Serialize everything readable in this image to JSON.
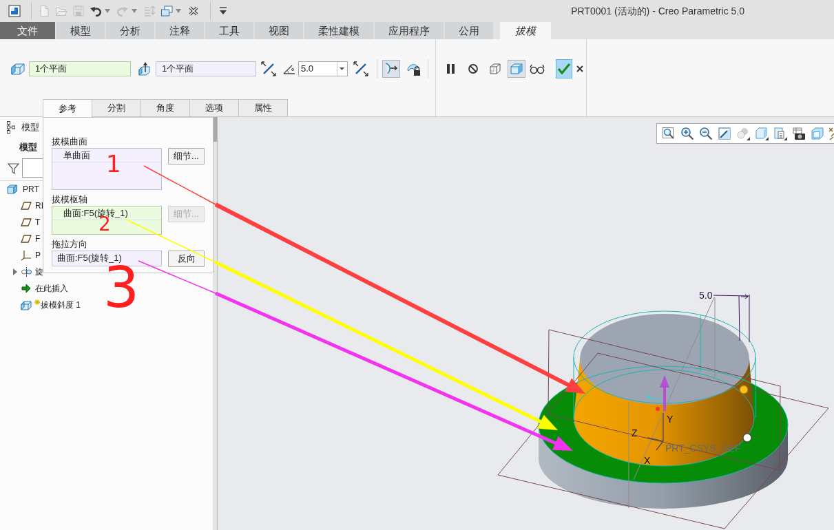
{
  "window": {
    "title": "PRT0001 (活动的) - Creo Parametric 5.0"
  },
  "quick_access": [
    {
      "kind": "app",
      "disabled": false,
      "menu": false
    },
    {
      "kind": "new",
      "disabled": true,
      "menu": false
    },
    {
      "kind": "open",
      "disabled": true,
      "menu": false
    },
    {
      "kind": "save",
      "disabled": true,
      "menu": false
    },
    {
      "kind": "undo",
      "disabled": false,
      "menu": true
    },
    {
      "kind": "redo",
      "disabled": true,
      "menu": true
    },
    {
      "kind": "regenerate",
      "disabled": true,
      "menu": false
    },
    {
      "kind": "windows",
      "disabled": false,
      "menu": true
    },
    {
      "kind": "close",
      "disabled": false,
      "menu": false
    },
    {
      "kind": "customize",
      "disabled": false,
      "menu": false
    }
  ],
  "ribbon_tabs": [
    {
      "label": "文件",
      "kind": "file",
      "selected": false
    },
    {
      "label": "模型",
      "kind": "tab",
      "selected": false
    },
    {
      "label": "分析",
      "kind": "tab",
      "selected": false
    },
    {
      "label": "注释",
      "kind": "tab",
      "selected": false
    },
    {
      "label": "工具",
      "kind": "tab",
      "selected": false
    },
    {
      "label": "视图",
      "kind": "tab",
      "selected": false
    },
    {
      "label": "柔性建模",
      "kind": "tab",
      "selected": false
    },
    {
      "label": "应用程序",
      "kind": "tab",
      "selected": false
    },
    {
      "label": "公用",
      "kind": "tab",
      "selected": false
    },
    {
      "label": "拔模",
      "kind": "contextual",
      "selected": true
    }
  ],
  "dashboard": {
    "pivot_field": {
      "value": "1个平面",
      "active": true
    },
    "direction_field": {
      "value": "1个平面",
      "active": false
    },
    "angle_field": {
      "value": "5.0"
    },
    "tool_buttons": [
      {
        "kind": "surface-pick",
        "selected": true
      },
      {
        "kind": "lock",
        "selected": false
      }
    ],
    "control_buttons": [
      {
        "kind": "pause",
        "selected": false
      },
      {
        "kind": "stop",
        "selected": false
      },
      {
        "kind": "preview",
        "selected": false
      },
      {
        "kind": "verify",
        "selected": true
      },
      {
        "kind": "glasses",
        "selected": false
      }
    ],
    "actions": [
      {
        "kind": "apply",
        "highlighted": true
      },
      {
        "kind": "cancel",
        "highlighted": false
      }
    ]
  },
  "sub_tabs": [
    {
      "label": "参考",
      "selected": true
    },
    {
      "label": "分割",
      "selected": false
    },
    {
      "label": "角度",
      "selected": false
    },
    {
      "label": "选项",
      "selected": false
    },
    {
      "label": "属性",
      "selected": false
    }
  ],
  "reference_panel": {
    "sections": [
      {
        "label": "拔模曲面",
        "kind": "list",
        "active": false,
        "items": [
          "单曲面"
        ],
        "button": {
          "label": "细节...",
          "disabled": false
        }
      },
      {
        "label": "拔模枢轴",
        "kind": "list",
        "active": true,
        "items": [
          "曲面:F5(旋转_1)"
        ],
        "button": {
          "label": "细节...",
          "disabled": true
        }
      },
      {
        "label": "拖拉方向",
        "kind": "single",
        "active": false,
        "items": [
          "曲面:F5(旋转_1)"
        ],
        "button": {
          "label": "反向",
          "disabled": false
        }
      }
    ]
  },
  "model_tree": {
    "title": "模型",
    "subtitle": "模型",
    "root": {
      "label": "PRT",
      "kind": "part",
      "children": [
        {
          "label": "RI",
          "kind": "plane"
        },
        {
          "label": "T",
          "kind": "plane"
        },
        {
          "label": "F",
          "kind": "plane"
        },
        {
          "label": "P",
          "kind": "csys"
        },
        {
          "label": "旋",
          "kind": "revolve",
          "expanded": false
        },
        {
          "label": "在此插入",
          "kind": "insert"
        },
        {
          "label": "拔模斜度 1",
          "kind": "draft",
          "flagged": true
        }
      ]
    }
  },
  "viewport": {
    "toolbar": [
      {
        "kind": "zoom-fit",
        "menu": false
      },
      {
        "kind": "zoom-in",
        "menu": false
      },
      {
        "kind": "zoom-out",
        "menu": false
      },
      {
        "kind": "repaint",
        "menu": false
      },
      {
        "kind": "display-style",
        "menu": true
      },
      {
        "kind": "orientation",
        "menu": true
      },
      {
        "kind": "views",
        "menu": true
      },
      {
        "kind": "snapshot",
        "menu": false
      },
      {
        "kind": "section",
        "menu": false
      },
      {
        "kind": "datum"
      }
    ],
    "model": {
      "dimension": "5.0",
      "axes": [
        {
          "label": "Y"
        },
        {
          "label": "Z"
        },
        {
          "label": "X"
        }
      ],
      "csys": "PRT_CSYS_DEF"
    }
  },
  "annotations": {
    "numbers": [
      {
        "label": "1"
      },
      {
        "label": "2"
      },
      {
        "label": "3"
      }
    ],
    "arrows": [
      {
        "color": "#ff4040"
      },
      {
        "color": "#ffff00"
      },
      {
        "color": "#f233f0"
      }
    ]
  }
}
